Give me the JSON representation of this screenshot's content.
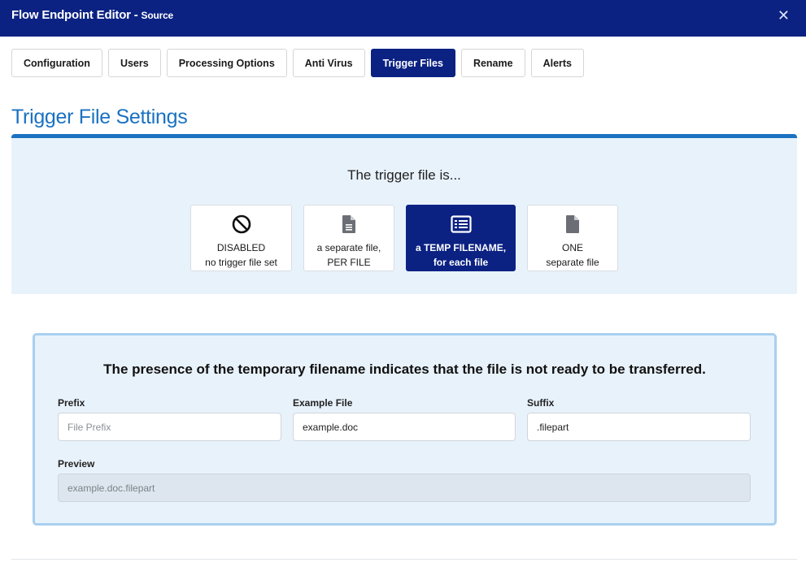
{
  "window": {
    "title": "Flow Endpoint Editor",
    "subtitle": "Source",
    "close_glyph": "✕"
  },
  "tabs": [
    {
      "label": "Configuration",
      "active": false
    },
    {
      "label": "Users",
      "active": false
    },
    {
      "label": "Processing Options",
      "active": false
    },
    {
      "label": "Anti Virus",
      "active": false
    },
    {
      "label": "Trigger Files",
      "active": true
    },
    {
      "label": "Rename",
      "active": false
    },
    {
      "label": "Alerts",
      "active": false
    }
  ],
  "heading": "Trigger File Settings",
  "trigger": {
    "question": "The trigger file is...",
    "options": [
      {
        "line1": "DISABLED",
        "line2": "no trigger file set",
        "icon": "ban-icon",
        "active": false
      },
      {
        "line1": "a separate file,",
        "line2": "PER FILE",
        "icon": "file-text-icon",
        "active": false
      },
      {
        "line1": "a TEMP FILENAME,",
        "line2": "for each file",
        "icon": "list-icon",
        "active": true
      },
      {
        "line1": "ONE",
        "line2": "separate file",
        "icon": "file-icon",
        "active": false
      }
    ]
  },
  "temp": {
    "message": "The presence of the temporary filename indicates that the file is not ready to be transferred.",
    "prefix": {
      "label": "Prefix",
      "value": "",
      "placeholder": "File Prefix"
    },
    "example": {
      "label": "Example File",
      "value": "example.doc"
    },
    "suffix": {
      "label": "Suffix",
      "value": ".filepart"
    },
    "preview": {
      "label": "Preview",
      "value": "example.doc.filepart"
    }
  },
  "colors": {
    "navy": "#0b2283",
    "accent": "#1a72c1",
    "panel_bg": "#e8f2fb"
  }
}
